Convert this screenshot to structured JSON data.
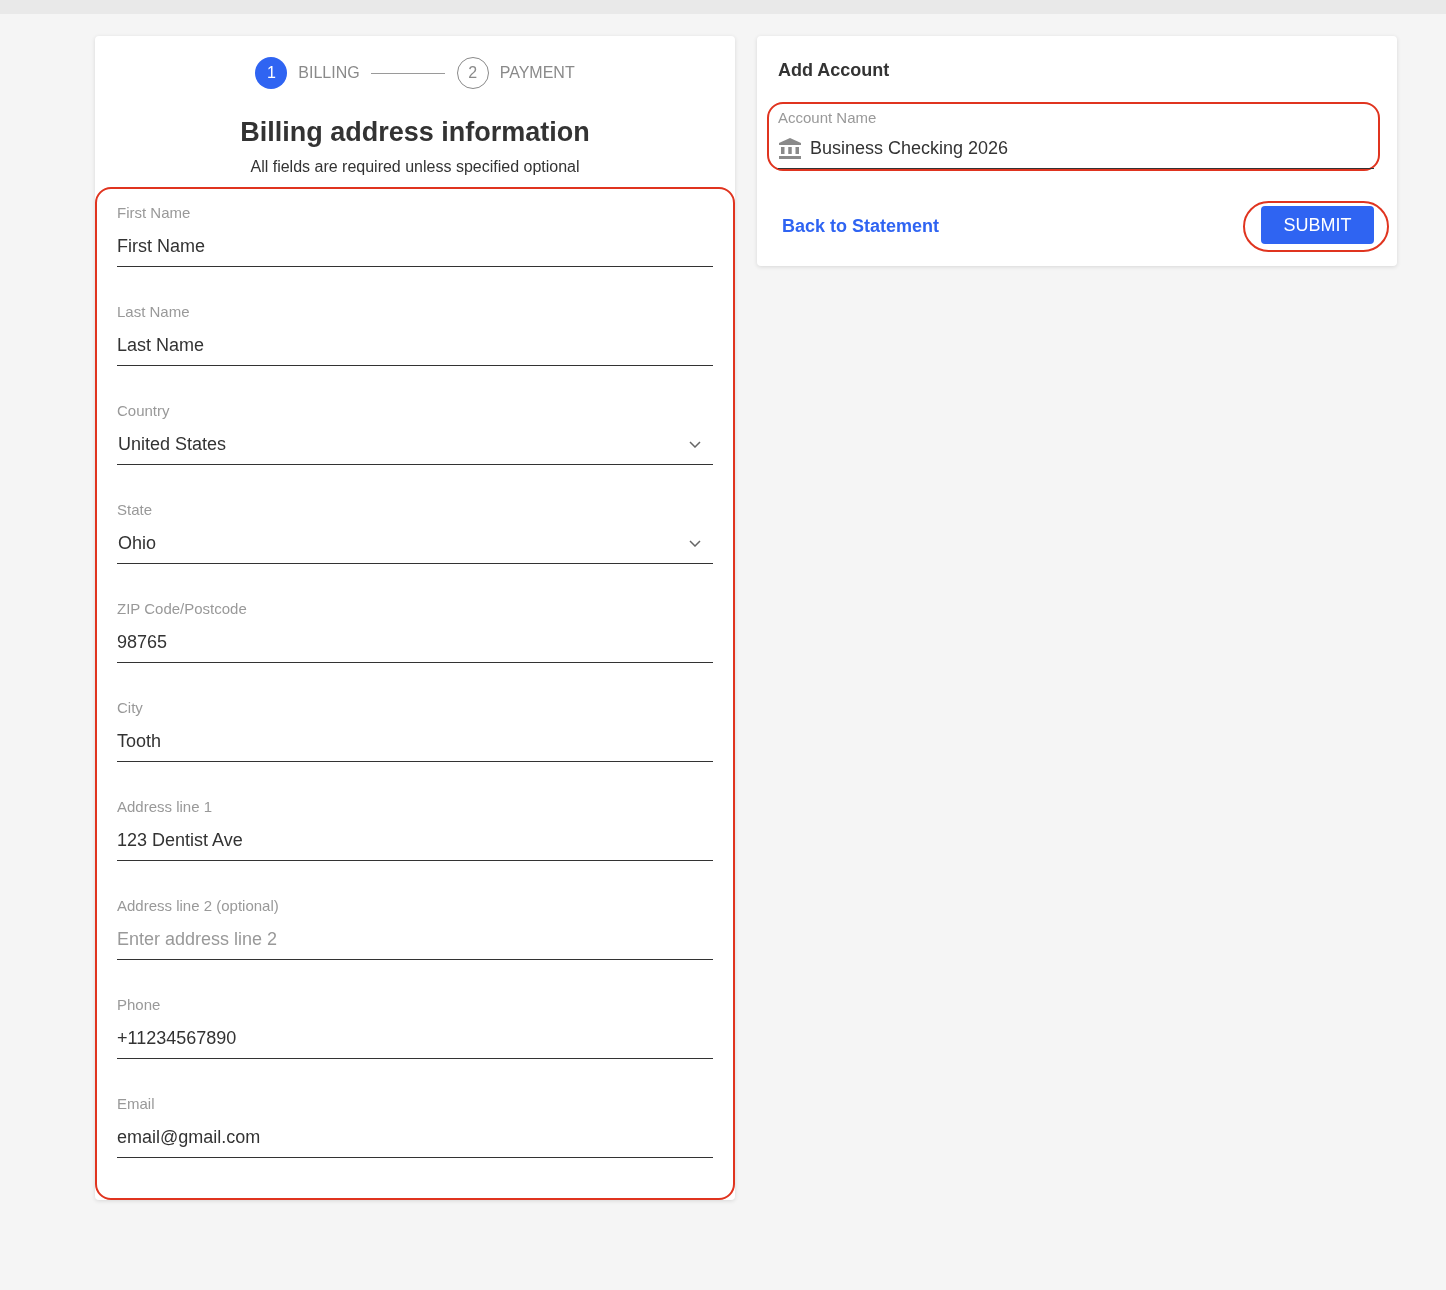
{
  "stepper": {
    "steps": [
      {
        "number": "1",
        "label": "BILLING",
        "selected": true
      },
      {
        "number": "2",
        "label": "PAYMENT",
        "selected": false
      }
    ]
  },
  "billing_form": {
    "title": "Billing address information",
    "subtitle": "All fields are required unless specified optional",
    "highlighted": true,
    "fields": [
      {
        "kind": "text",
        "label": "First Name",
        "value": "First Name"
      },
      {
        "kind": "text",
        "label": "Last Name",
        "value": "Last Name"
      },
      {
        "kind": "select",
        "label": "Country",
        "value": "United States"
      },
      {
        "kind": "select",
        "label": "State",
        "value": "Ohio"
      },
      {
        "kind": "text",
        "label": "ZIP Code/Postcode",
        "value": "98765"
      },
      {
        "kind": "text",
        "label": "City",
        "value": "Tooth"
      },
      {
        "kind": "text",
        "label": "Address line 1",
        "value": "123 Dentist Ave"
      },
      {
        "kind": "text",
        "label": "Address line 2 (optional)",
        "placeholder": "Enter address line 2"
      },
      {
        "kind": "text",
        "label": "Phone",
        "value": "+11234567890"
      },
      {
        "kind": "text",
        "label": "Email",
        "value": "email@gmail.com"
      }
    ]
  },
  "add_account": {
    "title": "Add Account",
    "account_name": {
      "label": "Account Name",
      "value": "Business Checking 2026",
      "highlighted": true
    },
    "back_link": "Back to Statement",
    "submit": {
      "label": "SUBMIT",
      "highlighted": true
    }
  }
}
